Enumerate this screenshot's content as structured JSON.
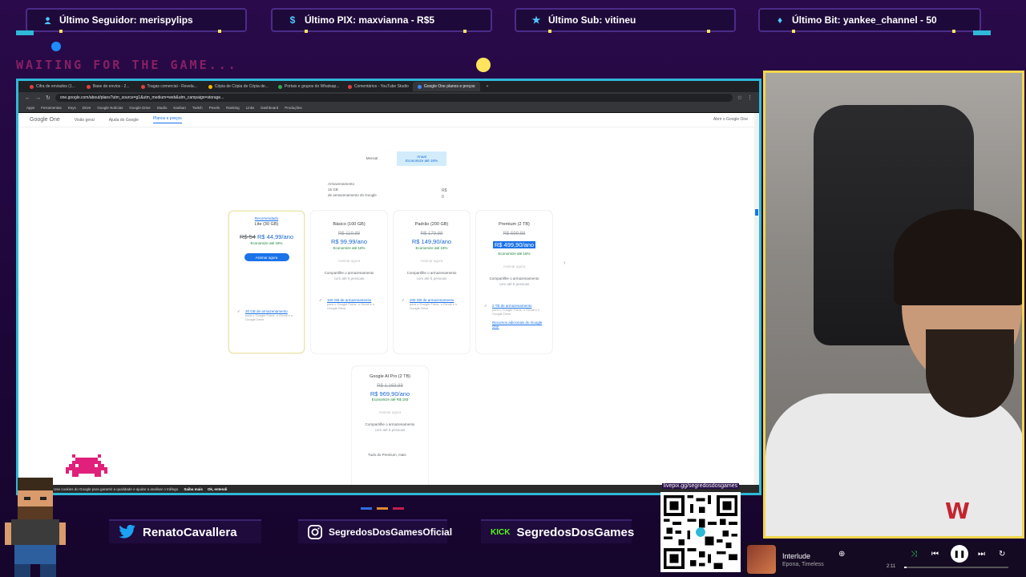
{
  "alerts": [
    {
      "label": "Último Seguidor: merispylips",
      "icon": "person-icon",
      "color": "#4cc9ff"
    },
    {
      "label": "Último PIX: maxvianna - R$5",
      "icon": "dollar-icon",
      "color": "#4cc9ff"
    },
    {
      "label": "Último Sub: vitineu",
      "icon": "star-icon",
      "color": "#4cc9ff"
    },
    {
      "label": "Último Bit: yankee_channel - 50",
      "icon": "diamond-icon",
      "color": "#4cc9ff"
    }
  ],
  "waiting_text": "WAITING FOR THE GAME...",
  "browser": {
    "tabs": [
      "Cifra de enviados (1...",
      "Base de envios - 2...",
      "Tragas comercial - Revela...",
      "Cópia de Cópia de Cópia de...",
      "Portais e grupos do Whatsap...",
      "Comentários - YouTube Studio",
      "Google One planos e preços"
    ],
    "url": "one.google.com/about/plans?utm_source=g1&utm_medium=web&utm_campaign=storage...",
    "bookmarks": [
      "Apps",
      "Ferramentas",
      "Keys",
      "Drive",
      "Google Notícias",
      "Google Drive",
      "Studio",
      "Kanban",
      "Twitch",
      "Pexels",
      "Ranking",
      "Links",
      "Dashboard",
      "Produções"
    ],
    "header": {
      "logo": "Google One",
      "nav": [
        "Visão geral",
        "Ajuda do Google",
        "Planos e preços"
      ],
      "active_nav": 2,
      "right": "Abrir o Google One"
    },
    "toggle": {
      "monthly": "Mensal",
      "annual": "Anual",
      "annual_sub": "Economize até 16%",
      "active": "annual"
    },
    "usage": {
      "line1": "Armazenamento",
      "line2": "15 GB",
      "line3": "de armazenamento do Google",
      "value": "R$ 0"
    },
    "plans": [
      {
        "badge": "Recomendado",
        "name": "Lite (30 GB)",
        "old": "",
        "price_strike": "R$ 54",
        "price": "R$ 44,99/ano",
        "save": "Economize até 16%",
        "button": "Assinar agora",
        "share": "",
        "share2": "",
        "feature": "30 GB de armazenamento",
        "fdesc": "para o Google Fotos, o Gmail e o Google Drive",
        "extra": "",
        "highlight": false
      },
      {
        "badge": "",
        "name": "Básico (100 GB)",
        "old": "R$ 119,88",
        "price_strike": "",
        "price": "R$ 99,99/ano",
        "save": "Economize até 16%",
        "button": "Assinar agora",
        "share": "Compartilhe o armazenamento",
        "share2": "com até 5 pessoas",
        "feature": "100 GB de armazenamento",
        "fdesc": "para o Google Fotos, o Gmail e o Google Drive",
        "extra": "",
        "highlight": false
      },
      {
        "badge": "",
        "name": "Padrão (200 GB)",
        "old": "R$ 179,88",
        "price_strike": "",
        "price": "R$ 149,90/ano",
        "save": "Economize até 16%",
        "button": "Assinar agora",
        "share": "Compartilhe o armazenamento",
        "share2": "com até 5 pessoas",
        "feature": "200 GB de armazenamento",
        "fdesc": "para o Google Fotos, o Gmail e o Google Drive",
        "extra": "",
        "highlight": false
      },
      {
        "badge": "",
        "name": "Premium (2 TB)",
        "old": "R$ 599,88",
        "price_strike": "",
        "price": "R$ 499,90/ano",
        "save": "Economize até 16%",
        "button": "Assinar agora",
        "share": "Compartilhe o armazenamento",
        "share2": "com até 5 pessoas",
        "feature": "2 TB de armazenamento",
        "fdesc": "para o Google Fotos, o Gmail e o Google Drive",
        "extra": "Recursos adicionais do Google One",
        "highlight": true
      }
    ],
    "ai_plan": {
      "name": "Google AI Pro (2 TB)",
      "old": "R$ 1.163,88",
      "price": "R$ 969,90/ano",
      "save": "Economize até R$ 193",
      "button": "Assinar agora",
      "share": "Compartilhe o armazenamento",
      "share2": "com até 5 pessoas",
      "feature": "Tudo do Premium, mais"
    },
    "snackbar": {
      "text": "Use cookies do Google para garantir a qualidade e ajudar a analisar o tráfego.",
      "action1": "Saiba mais",
      "action2": "Ok, entendi"
    }
  },
  "social": {
    "twitter": "RenatoCavallera",
    "instagram": "SegredosDosGamesOficial",
    "kick_tag": "KICK",
    "kick": "SegredosDosGames"
  },
  "qr_label": "livepix.gg/segredosdosgames",
  "music": {
    "title": "Interlude",
    "artist": "Epona, Timeless",
    "time": "2:11",
    "progress": 0.02
  },
  "colors": {
    "accent_cyan": "#2fb8d8",
    "webcam_border": "#f2d74c",
    "google_blue": "#1a73e8"
  }
}
